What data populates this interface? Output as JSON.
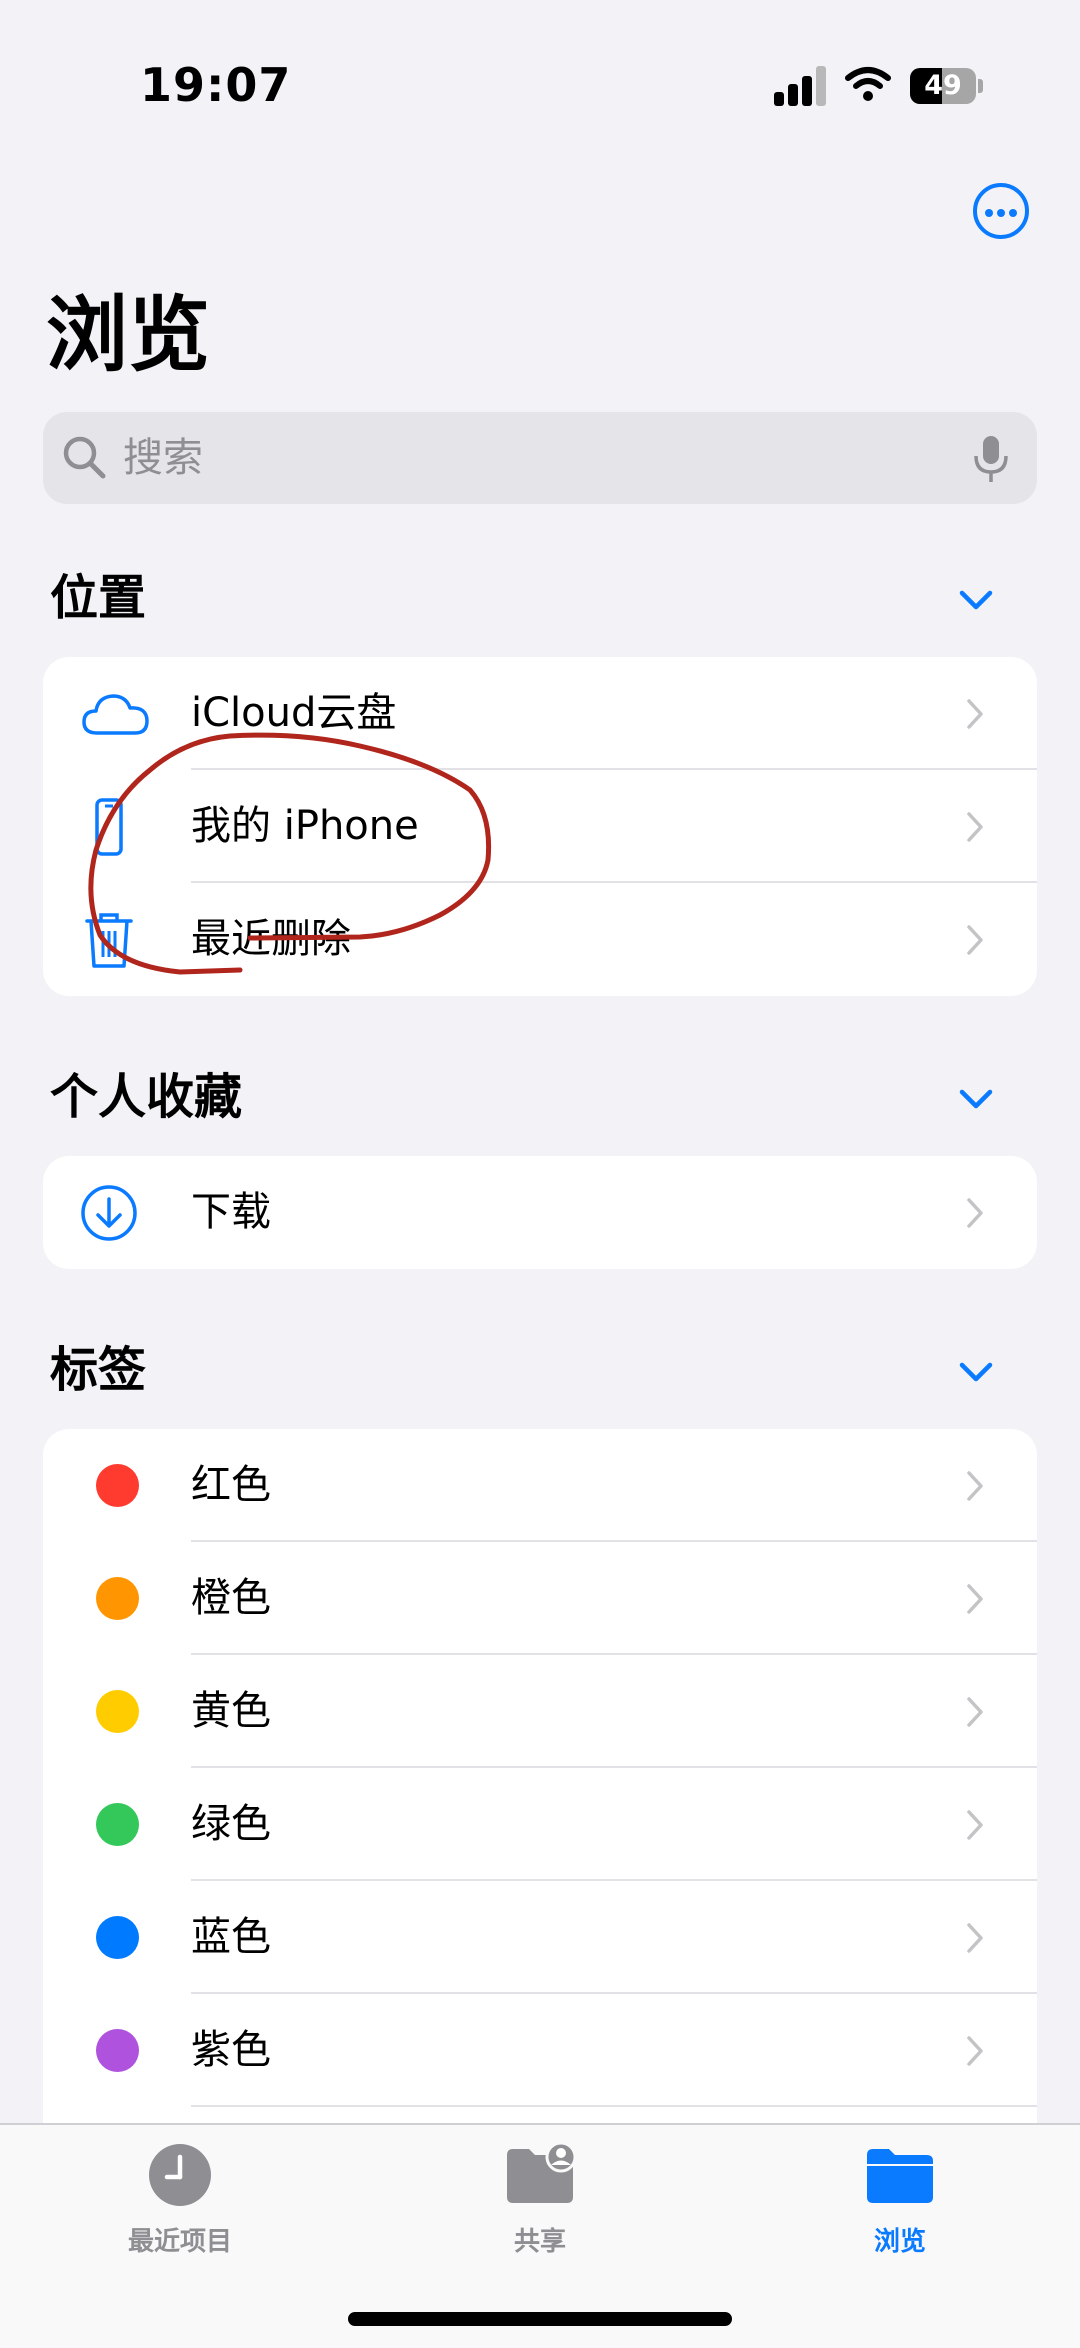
{
  "status_bar": {
    "time": "19:07",
    "battery_percent": 49,
    "battery_label": "49"
  },
  "header": {
    "title": "浏览",
    "more_icon": "ellipsis-circle-icon"
  },
  "search": {
    "placeholder": "搜索",
    "value": ""
  },
  "sections": {
    "locations": {
      "title": "位置",
      "items": [
        {
          "label": "iCloud云盘",
          "icon": "icloud-icon"
        },
        {
          "label": "我的 iPhone",
          "icon": "iphone-icon"
        },
        {
          "label": "最近删除",
          "icon": "trash-icon"
        }
      ]
    },
    "favorites": {
      "title": "个人收藏",
      "items": [
        {
          "label": "下载",
          "icon": "download-circle-icon"
        }
      ]
    },
    "tags": {
      "title": "标签",
      "items": [
        {
          "label": "红色",
          "color": "#ff3b30"
        },
        {
          "label": "橙色",
          "color": "#ff9500"
        },
        {
          "label": "黄色",
          "color": "#ffcc00"
        },
        {
          "label": "绿色",
          "color": "#34c759"
        },
        {
          "label": "蓝色",
          "color": "#007aff"
        },
        {
          "label": "紫色",
          "color": "#af52de"
        }
      ]
    }
  },
  "tab_bar": {
    "tabs": [
      {
        "label": "最近项目",
        "icon": "clock-icon",
        "active": false
      },
      {
        "label": "共享",
        "icon": "shared-folder-icon",
        "active": false
      },
      {
        "label": "浏览",
        "icon": "folder-icon",
        "active": true
      }
    ]
  },
  "colors": {
    "accent": "#0a7aff",
    "background": "#f2f2f7",
    "annotation_ink": "#b0261c"
  }
}
